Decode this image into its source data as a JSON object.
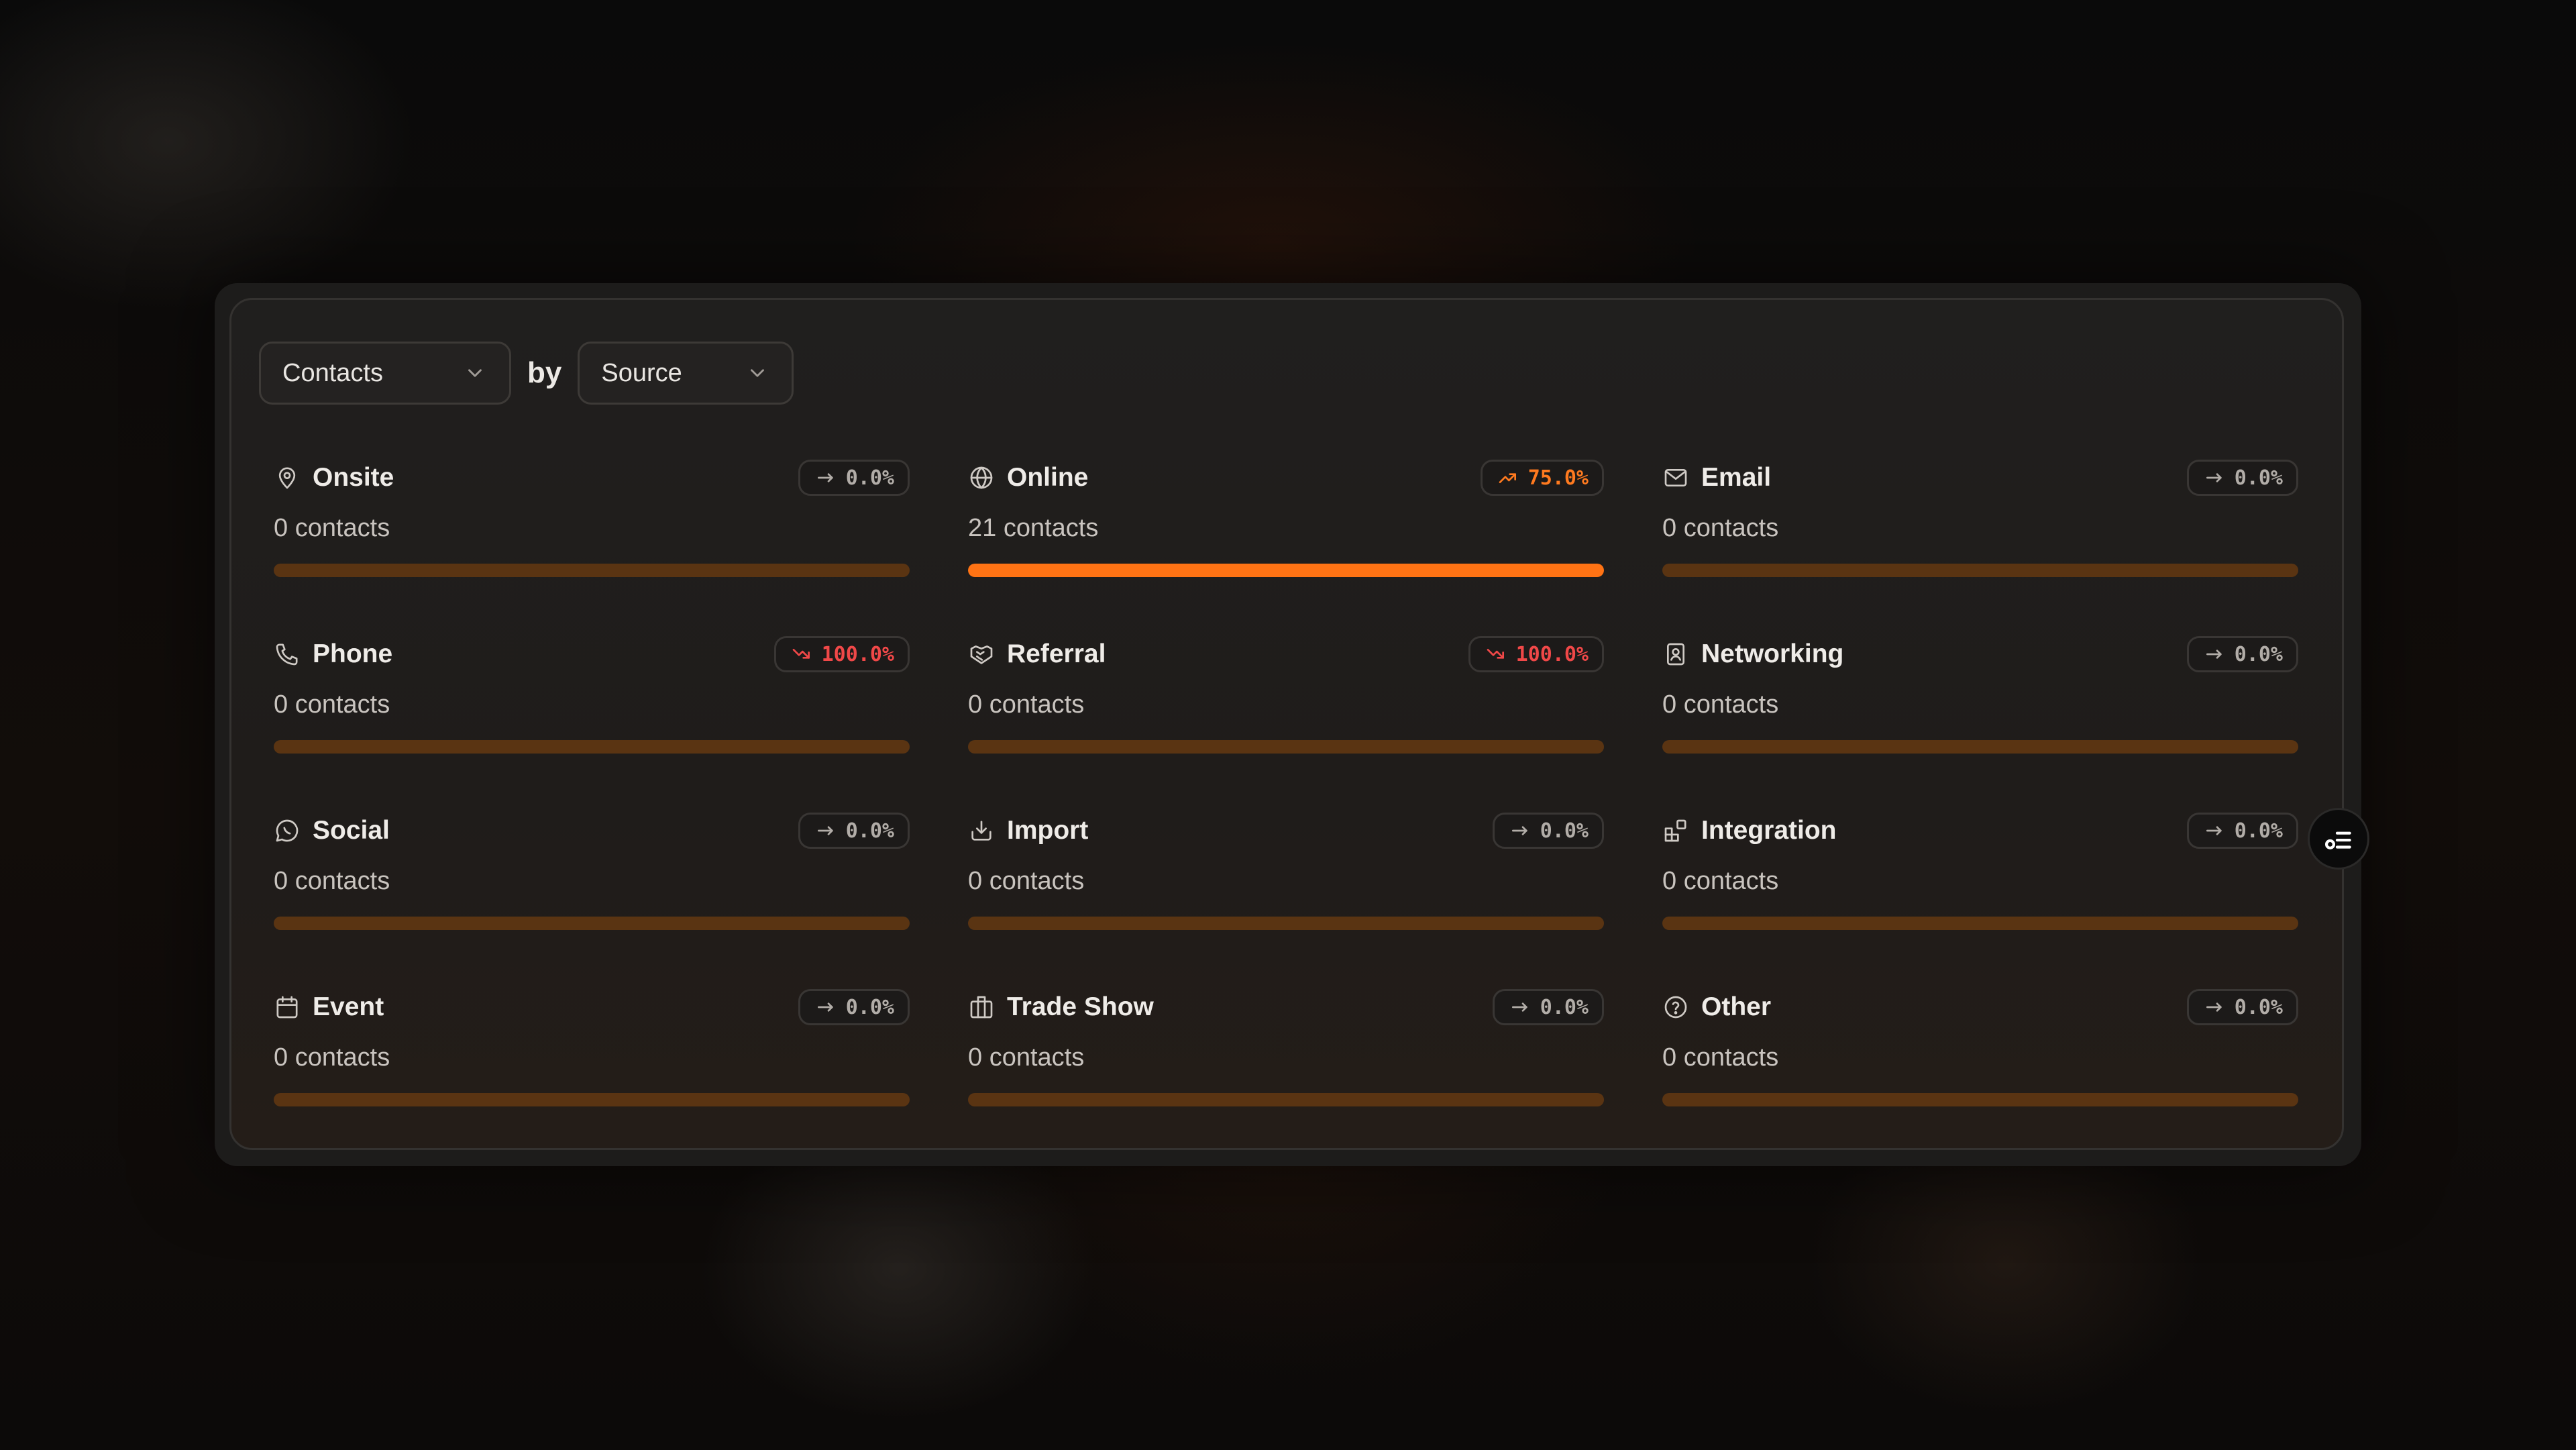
{
  "toolbar": {
    "metric_select": "Contacts",
    "by_label": "by",
    "group_select": "Source"
  },
  "theme": {
    "accent": "#ff7314",
    "bar_track": "#5a3412",
    "trend_up": "#ff7a1f",
    "trend_down": "#f04848",
    "trend_flat": "#b2ada8"
  },
  "cards": [
    {
      "title": "Onsite",
      "icon": "map-pin-icon",
      "count": "0 contacts",
      "trend": "flat",
      "change": "0.0%",
      "share": 0.0
    },
    {
      "title": "Online",
      "icon": "globe-icon",
      "count": "21 contacts",
      "trend": "up",
      "change": "75.0%",
      "share": 1.0
    },
    {
      "title": "Email",
      "icon": "mail-icon",
      "count": "0 contacts",
      "trend": "flat",
      "change": "0.0%",
      "share": 0.0
    },
    {
      "title": "Phone",
      "icon": "phone-icon",
      "count": "0 contacts",
      "trend": "down",
      "change": "100.0%",
      "share": 0.0
    },
    {
      "title": "Referral",
      "icon": "handshake-icon",
      "count": "0 contacts",
      "trend": "down",
      "change": "100.0%",
      "share": 0.0
    },
    {
      "title": "Networking",
      "icon": "contact-book-icon",
      "count": "0 contacts",
      "trend": "flat",
      "change": "0.0%",
      "share": 0.0
    },
    {
      "title": "Social",
      "icon": "chat-bubble-icon",
      "count": "0 contacts",
      "trend": "flat",
      "change": "0.0%",
      "share": 0.0
    },
    {
      "title": "Import",
      "icon": "import-icon",
      "count": "0 contacts",
      "trend": "flat",
      "change": "0.0%",
      "share": 0.0
    },
    {
      "title": "Integration",
      "icon": "blocks-icon",
      "count": "0 contacts",
      "trend": "flat",
      "change": "0.0%",
      "share": 0.0
    },
    {
      "title": "Event",
      "icon": "calendar-icon",
      "count": "0 contacts",
      "trend": "flat",
      "change": "0.0%",
      "share": 0.0
    },
    {
      "title": "Trade Show",
      "icon": "booth-icon",
      "count": "0 contacts",
      "trend": "flat",
      "change": "0.0%",
      "share": 0.0
    },
    {
      "title": "Other",
      "icon": "question-circle-icon",
      "count": "0 contacts",
      "trend": "flat",
      "change": "0.0%",
      "share": 0.0
    }
  ],
  "float_button": {
    "icon": "settings-toggle-icon"
  }
}
